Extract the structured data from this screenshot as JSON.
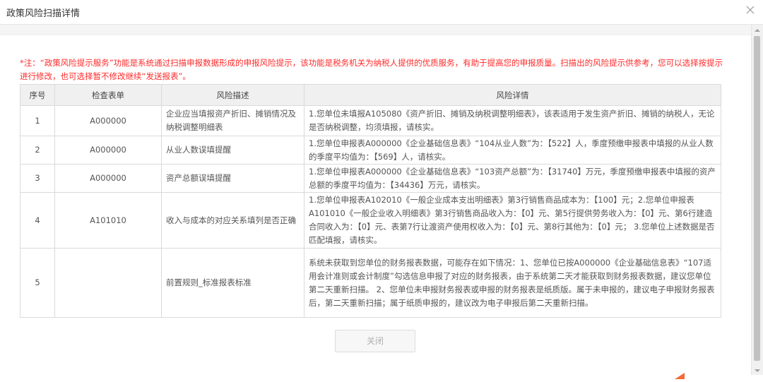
{
  "dialog": {
    "title": "政策风险扫描详情",
    "notice": "*注：“政策风险提示服务”功能是系统通过扫描申报数据形成的申报风险提示，该功能是税务机关为纳税人提供的优质服务，有助于提高您的申报质量。扫描出的风险提示供参考，您可以选择按提示进行修改，也可选择暂不修改继续“发送报表”。",
    "close_button_label": "关闭"
  },
  "table": {
    "headers": [
      "序号",
      "检查表单",
      "风险描述",
      "风险详情"
    ],
    "rows": [
      {
        "index": "1",
        "form": "A000000",
        "desc": "企业应当填报资产折旧、摊销情况及纳税调整明细表",
        "detail": "1.您单位未填报A105080《资产折旧、摊销及纳税调整明细表》，该表适用于发生资产折旧、摊销的纳税人，无论是否纳税调整，均须填报，请核实。"
      },
      {
        "index": "2",
        "form": "A000000",
        "desc": "从业人数误填提醒",
        "detail": "1.您单位申报表A000000《企业基础信息表》“104从业人数”为：【522】人，季度预缴申报表中填报的从业人数的季度平均值为：【569】人，请核实。"
      },
      {
        "index": "3",
        "form": "A000000",
        "desc": "资产总额误填提醒",
        "detail": "1.您单位申报表A000000《企业基础信息表》“103资产总额”为：【31740】万元，季度预缴申报表中填报的资产总额的季度平均值为：【34436】万元，请核实。"
      },
      {
        "index": "4",
        "form": "A101010",
        "desc": "收入与成本的对应关系填列是否正确",
        "detail": "1.您单位申报表A102010《一般企业成本支出明细表》第3行销售商品成本为：【100】元；2.您单位申报表A101010《一般企业收入明细表》第3行销售商品收入为：【0】元、第5行提供劳务收入为：【0】元、第6行建造合同收入为：【0】元、表第7行让渡资产使用权收入为：【0】元、第8行其他为：【0】元； 3.您单位上述数据是否匹配填报，请核实。"
      },
      {
        "index": "5",
        "form": "",
        "desc": "前置规则_标准报表标准",
        "detail": "系统未获取到您单位的财务报表数据，可能存在如下情况：1、您单位已按A000000《企业基础信息表》“107适用会计准则或会计制度”勾选信息申报了对应的财务报表，由于系统第二天才能获取到财务报表数据，建议您单位第二天重新扫描。 2、您单位未申报财务报表或申报的财务报表是纸质版。属于未申报的，建议电子申报财务报表后，第二天重新扫描；属于纸质申报的，建议改为电子申报后第二天重新扫描。"
      }
    ]
  },
  "icons": {
    "close": "close-icon",
    "scroll_up": "scroll-up-arrow-icon",
    "scroll_down": "scroll-down-arrow-icon"
  },
  "colors": {
    "notice_text": "#ff2a2a",
    "header_bg": "#f0f0f0",
    "border": "#dadada",
    "button_text_disabled": "#b0b0b0",
    "corner_accent": "#f26b3a"
  }
}
